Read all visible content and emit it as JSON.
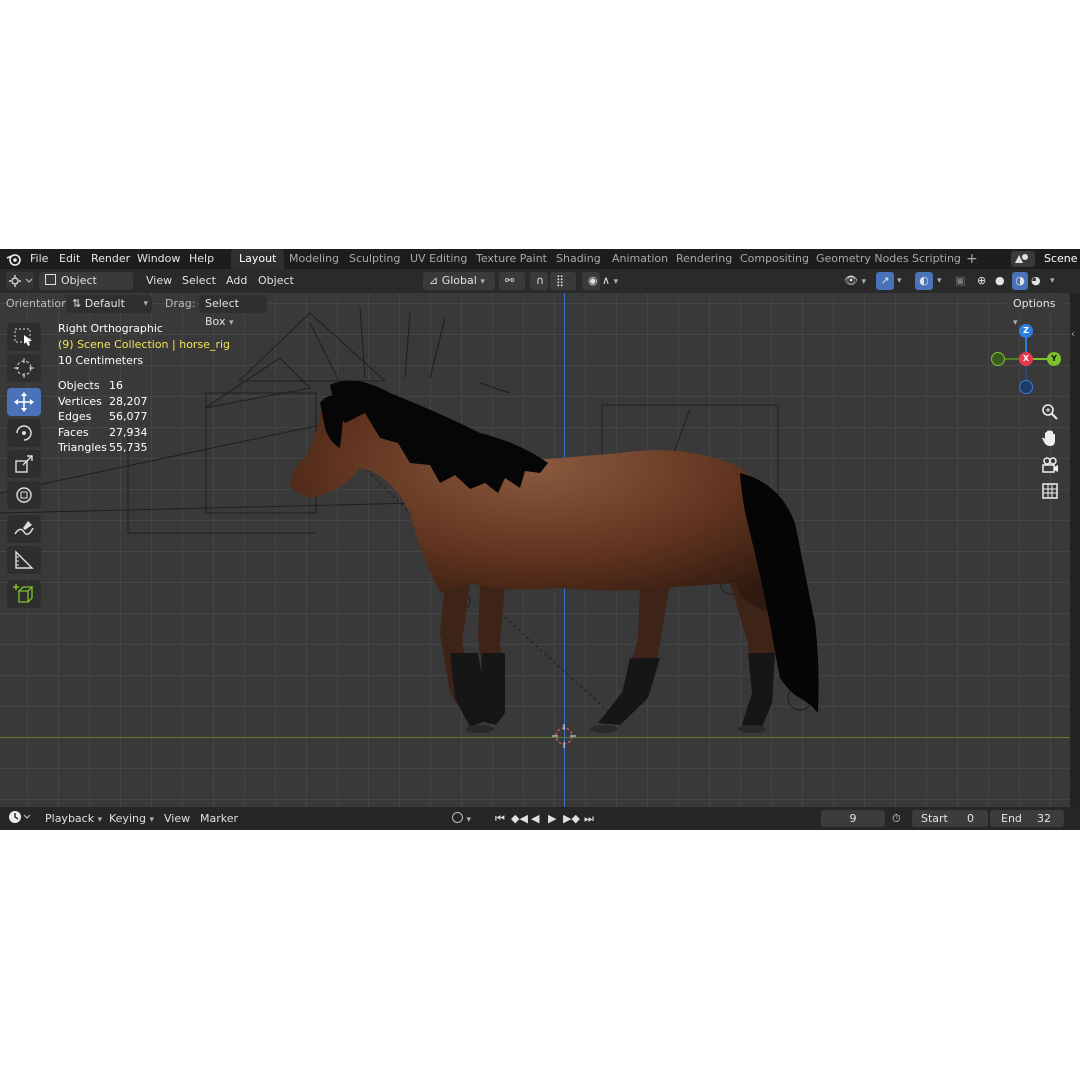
{
  "menu": {
    "items": [
      "File",
      "Edit",
      "Render",
      "Window",
      "Help"
    ],
    "workspaces": [
      "Layout",
      "Modeling",
      "Sculpting",
      "UV Editing",
      "Texture Paint",
      "Shading",
      "Animation",
      "Rendering",
      "Compositing",
      "Geometry Nodes",
      "Scripting"
    ],
    "active_workspace": "Layout",
    "add_tab": "+",
    "scene": "Scene"
  },
  "header": {
    "mode": "Object Mode",
    "menus": [
      "View",
      "Select",
      "Add",
      "Object"
    ],
    "transform_orientation": "Global"
  },
  "tool_settings": {
    "orientation_label": "Orientation:",
    "orientation_value": "Default",
    "drag_label": "Drag:",
    "drag_value": "Select Box",
    "options": "Options"
  },
  "viewport": {
    "view_name": "Right Orthographic",
    "collection": "(9) Scene Collection | horse_rig",
    "scale": "10 Centimeters",
    "stats": [
      {
        "label": "Objects",
        "value": "16"
      },
      {
        "label": "Vertices",
        "value": "28,207"
      },
      {
        "label": "Edges",
        "value": "56,077"
      },
      {
        "label": "Faces",
        "value": "27,934"
      },
      {
        "label": "Triangles",
        "value": "55,735"
      }
    ],
    "gizmo": {
      "z": "Z",
      "x": "X",
      "y": "Y"
    }
  },
  "colors": {
    "axis_x": "#e8394d",
    "axis_y": "#7ec22b",
    "axis_z": "#2e7ee0",
    "active_tool": "#4a72b8",
    "highlight_text": "#f3e45a"
  },
  "timeline": {
    "menus": [
      "Playback",
      "Keying",
      "View",
      "Marker"
    ],
    "current_frame": "9",
    "start_label": "Start",
    "start_value": "0",
    "end_label": "End",
    "end_value": "32"
  }
}
